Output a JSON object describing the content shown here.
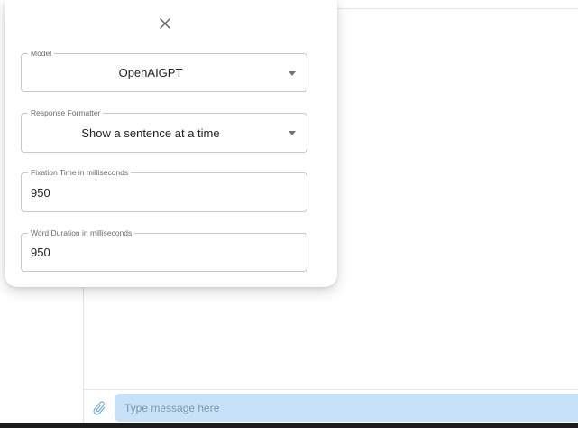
{
  "settings": {
    "model": {
      "label": "Model",
      "value": "OpenAIGPT"
    },
    "formatter": {
      "label": "Response Formatter",
      "value": "Show a sentence at a time"
    },
    "fixation": {
      "label": "Fixation Time in milliseconds",
      "value": "950"
    },
    "word_duration": {
      "label": "Word Duration in milliseconds",
      "value": "950"
    }
  },
  "composer": {
    "placeholder": "Type message here"
  },
  "icons": {
    "close": "close-icon",
    "attach": "paperclip-icon",
    "dropdown": "chevron-down-icon"
  },
  "colors": {
    "input_bg": "#c7e2f8",
    "attach_icon": "#6aa8d8"
  }
}
